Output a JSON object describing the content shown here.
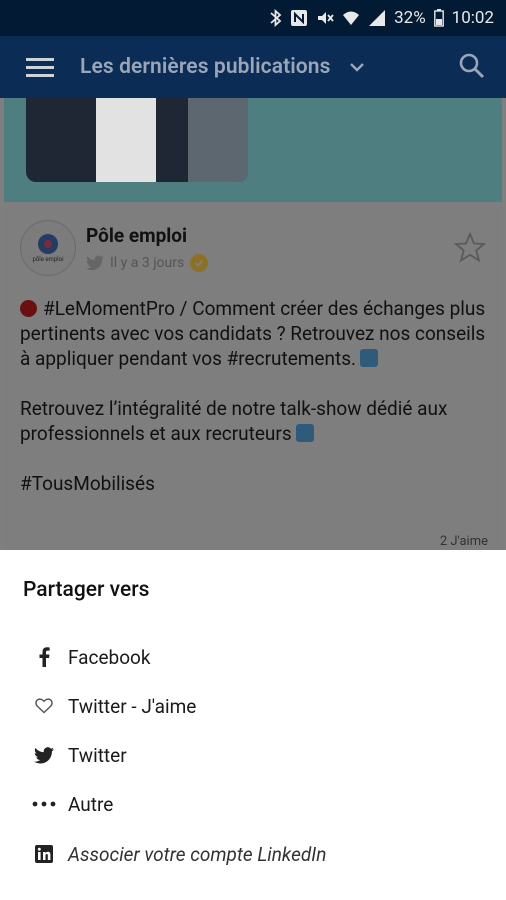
{
  "status_bar": {
    "battery": "32%",
    "time": "10:02"
  },
  "app_bar": {
    "title": "Les dernières publications"
  },
  "post": {
    "author": "Pôle emploi",
    "avatar_text": "pôle emploi",
    "time_ago": "Il y a 3 jours",
    "paragraphs": [
      "#LeMomentPro / Comment créer des échanges plus pertinents avec vos candidats ? Retrouvez nos conseils à appliquer pendant vos #recrutements.",
      "Retrouvez l’intégralité de notre talk-show dédié aux professionnels et aux recruteurs",
      "#TousMobilisés"
    ],
    "likes": "2 J'aime"
  },
  "share_sheet": {
    "title": "Partager vers",
    "items": [
      {
        "label": "Facebook",
        "icon": "facebook-icon"
      },
      {
        "label": "Twitter - J'aime",
        "icon": "heart-icon"
      },
      {
        "label": "Twitter",
        "icon": "twitter-icon"
      },
      {
        "label": "Autre",
        "icon": "more-dots-icon"
      },
      {
        "label": "Associer votre compte LinkedIn",
        "icon": "linkedin-icon"
      }
    ]
  }
}
